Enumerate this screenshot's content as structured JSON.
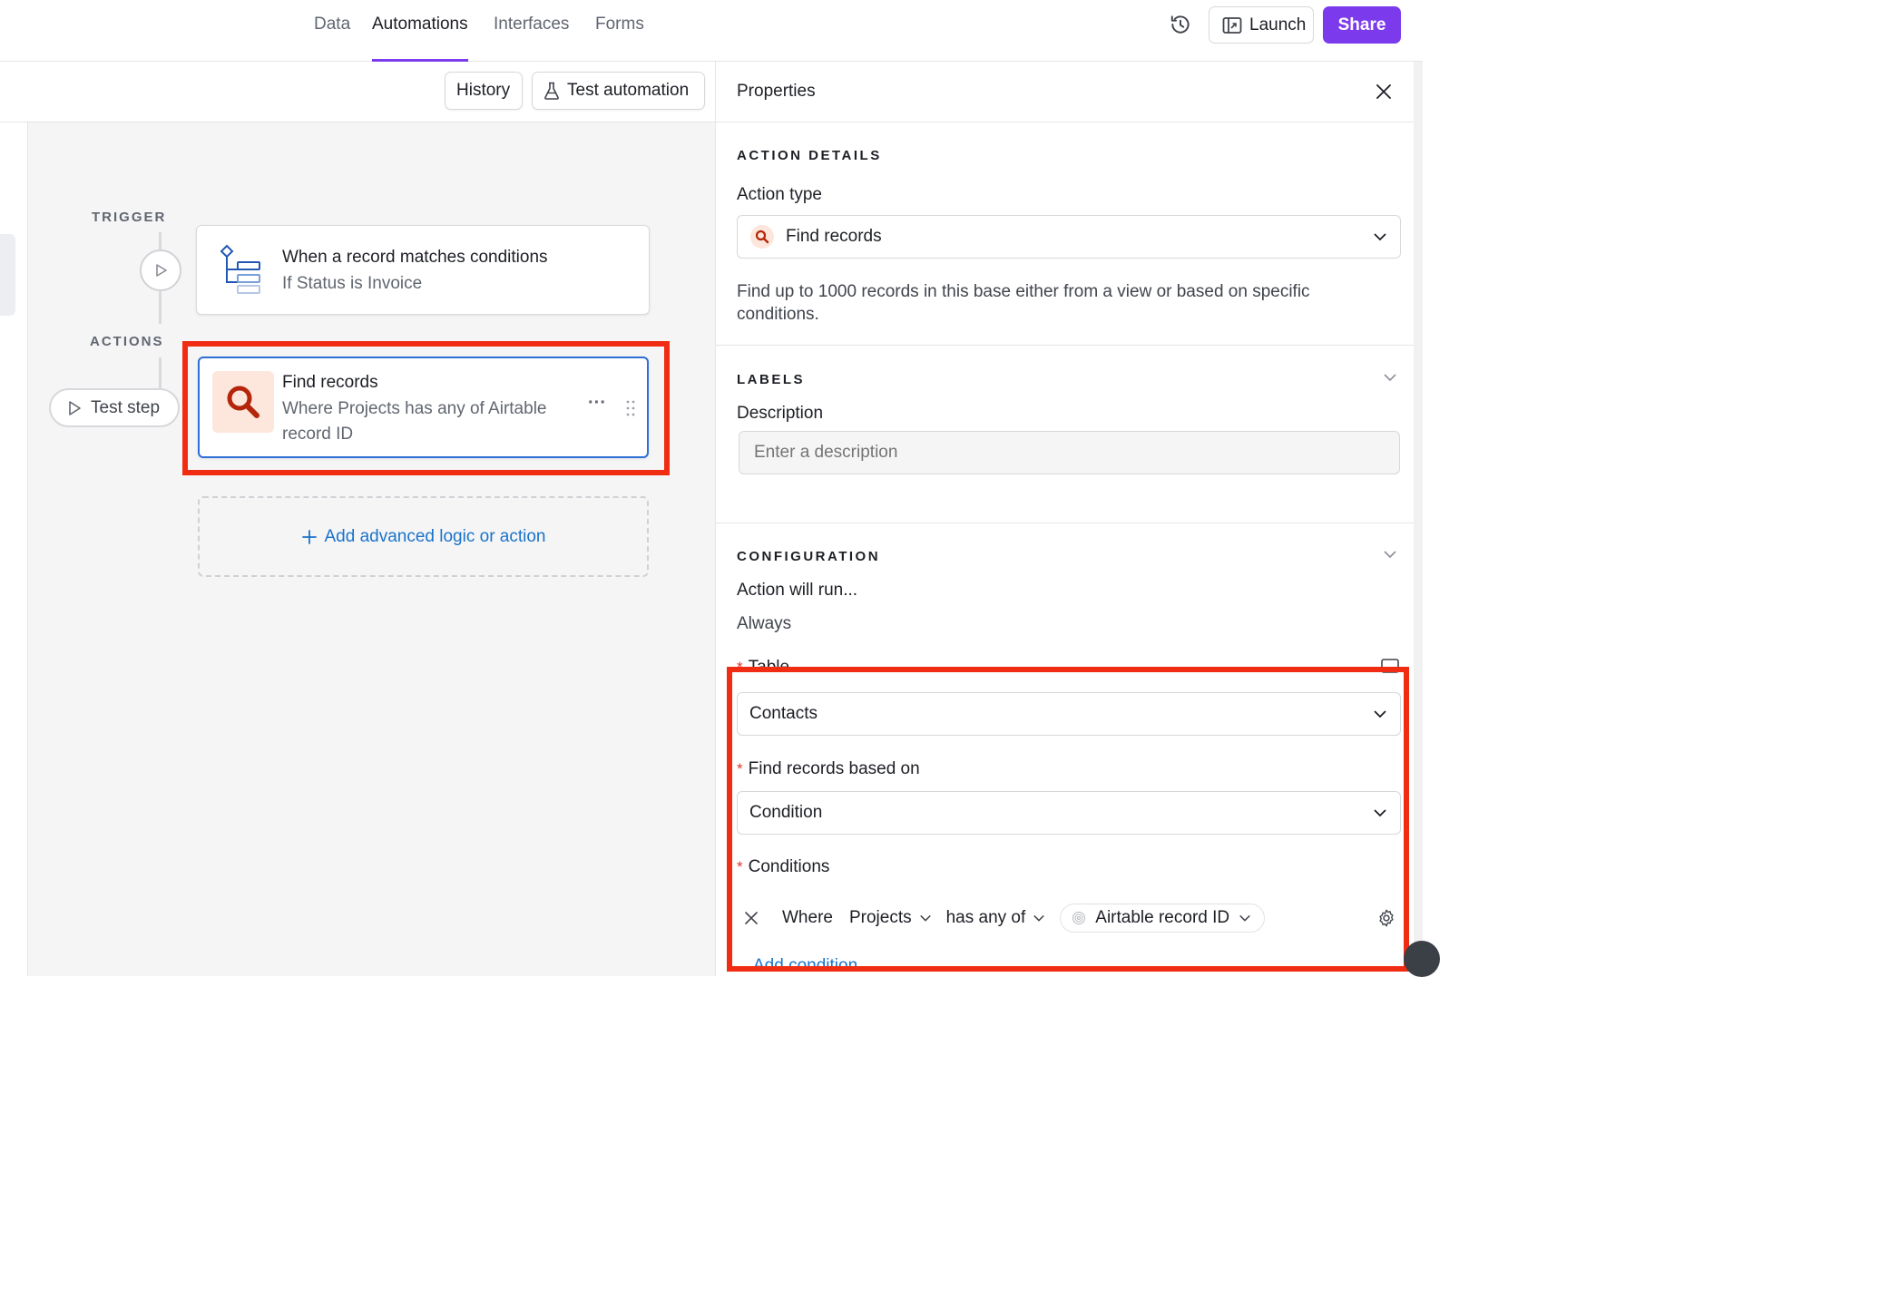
{
  "nav": {
    "tabs": [
      {
        "label": "Data"
      },
      {
        "label": "Automations"
      },
      {
        "label": "Interfaces"
      },
      {
        "label": "Forms"
      }
    ],
    "launch_label": "Launch",
    "share_label": "Share"
  },
  "toolbar": {
    "history_label": "History",
    "test_automation_label": "Test automation"
  },
  "flow": {
    "trigger_label": "TRIGGER",
    "actions_label": "ACTIONS",
    "test_step_label": "Test step",
    "trigger_card": {
      "title": "When a record matches conditions",
      "subtitle": "If Status is Invoice"
    },
    "action_card": {
      "title": "Find records",
      "subtitle_line1": "Where Projects has any of Airtable",
      "subtitle_line2": "record ID",
      "more_glyph": "···"
    },
    "add_logic_label": "Add advanced logic or action"
  },
  "properties": {
    "title": "Properties",
    "action_details_heading": "ACTION DETAILS",
    "action_type_label": "Action type",
    "action_type_value": "Find records",
    "action_description_line1": "Find up to 1000 records in this base either from a view or based on specific",
    "action_description_line2": "conditions.",
    "labels_heading": "LABELS",
    "description_label": "Description",
    "description_placeholder": "Enter a description",
    "configuration_heading": "CONFIGURATION",
    "action_will_run_label": "Action will run...",
    "action_will_run_value": "Always",
    "table_label": "Table",
    "table_value": "Contacts",
    "find_based_on_label": "Find records based on",
    "find_based_on_value": "Condition",
    "conditions_label": "Conditions",
    "condition": {
      "where": "Where",
      "field": "Projects",
      "operator": "has any of",
      "value": "Airtable record ID"
    },
    "add_condition_label": "Add condition",
    "required_mark": "*"
  },
  "colors": {
    "accent_purple": "#7c3aed",
    "highlight_red": "#f02c13",
    "link_blue": "#1a73c9",
    "selected_border": "#2d6fd6"
  }
}
